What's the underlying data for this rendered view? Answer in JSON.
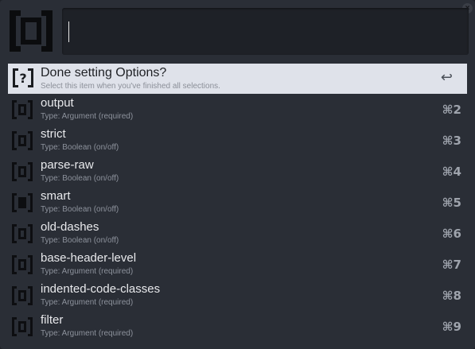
{
  "window": {
    "close_symbol": "×"
  },
  "search": {
    "value": "",
    "placeholder": ""
  },
  "colors": {
    "background": "#2a2e36",
    "search_field": "#1e2127",
    "selected_row": "#dfe2ea",
    "title_text": "#e8e9ec",
    "subtitle_text": "#8d929c"
  },
  "selected_item": {
    "icon": "question-bracket-icon",
    "title": "Done setting Options?",
    "subtitle": "Select this item when you've finished all selections.",
    "shortcut": "↩"
  },
  "items": [
    {
      "icon": "option-bracket-icon",
      "title": "output",
      "subtitle": "Type: Argument (required)",
      "shortcut": "⌘2"
    },
    {
      "icon": "option-bracket-icon",
      "title": "strict",
      "subtitle": "Type: Boolean  (on/off)",
      "shortcut": "⌘3"
    },
    {
      "icon": "option-bracket-icon",
      "title": "parse-raw",
      "subtitle": "Type: Boolean  (on/off)",
      "shortcut": "⌘4"
    },
    {
      "icon": "option-bracket-filled-icon",
      "title": "smart",
      "subtitle": "Type: Boolean  (on/off)",
      "shortcut": "⌘5"
    },
    {
      "icon": "option-bracket-icon",
      "title": "old-dashes",
      "subtitle": "Type: Boolean  (on/off)",
      "shortcut": "⌘6"
    },
    {
      "icon": "option-bracket-icon",
      "title": "base-header-level",
      "subtitle": "Type: Argument (required)",
      "shortcut": "⌘7"
    },
    {
      "icon": "option-bracket-icon",
      "title": "indented-code-classes",
      "subtitle": "Type: Argument (required)",
      "shortcut": "⌘8"
    },
    {
      "icon": "option-bracket-icon",
      "title": "filter",
      "subtitle": "Type: Argument (required)",
      "shortcut": "⌘9"
    }
  ]
}
